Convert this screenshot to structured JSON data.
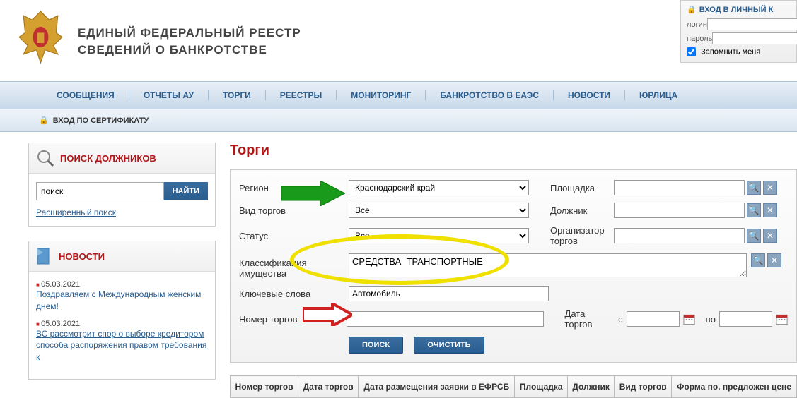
{
  "header": {
    "title_line1": "ЕДИНЫЙ  ФЕДЕРАЛЬНЫЙ  РЕЕСТР",
    "title_line2": "СВЕДЕНИЙ О БАНКРОТСТВЕ"
  },
  "login": {
    "title": "ВХОД В ЛИЧНЫЙ К",
    "login_label": "логин",
    "password_label": "пароль",
    "remember_label": "Запомнить меня"
  },
  "nav": [
    "СООБЩЕНИЯ",
    "ОТЧЕТЫ АУ",
    "ТОРГИ",
    "РЕЕСТРЫ",
    "МОНИТОРИНГ",
    "БАНКРОТСТВО В ЕАЭС",
    "НОВОСТИ",
    "ЮРЛИЦА"
  ],
  "cert_login": "ВХОД ПО СЕРТИФИКАТУ",
  "sidebar": {
    "search_title": "ПОИСК ДОЛЖНИКОВ",
    "search_value": "поиск",
    "find_btn": "НАЙТИ",
    "adv_search": "Расширенный поиск",
    "news_title": "НОВОСТИ",
    "news": [
      {
        "date": "05.03.2021",
        "text": "Поздравляем с Международным женским днем!"
      },
      {
        "date": "05.03.2021",
        "text": "ВС рассмотрит спор о выборе кредитором способа распоряжения правом требования к"
      }
    ]
  },
  "page": {
    "title": "Торги",
    "region_label": "Регион",
    "region_value": "Краснодарский край",
    "type_label": "Вид торгов",
    "type_value": "Все",
    "status_label": "Статус",
    "status_value": "Все",
    "class_label": "Классификация имущества",
    "class_value": "СРЕДСТВА  ТРАНСПОРТНЫЕ",
    "keywords_label": "Ключевые слова",
    "keywords_value": "Автомобиль",
    "number_label": "Номер торгов",
    "number_value": "",
    "platform_label": "Площадка",
    "debtor_label": "Должник",
    "organizer_label": "Организатор торгов",
    "date_label": "Дата торгов",
    "date_from": "с",
    "date_to": "по",
    "search_btn": "ПОИСК",
    "clear_btn": "ОЧИСТИТЬ"
  },
  "table": {
    "cols": [
      "Номер торгов",
      "Дата торгов",
      "Дата размещения заявки в ЕФРСБ",
      "Площадка",
      "Должник",
      "Вид торгов",
      "Форма по. предложен цене"
    ]
  }
}
